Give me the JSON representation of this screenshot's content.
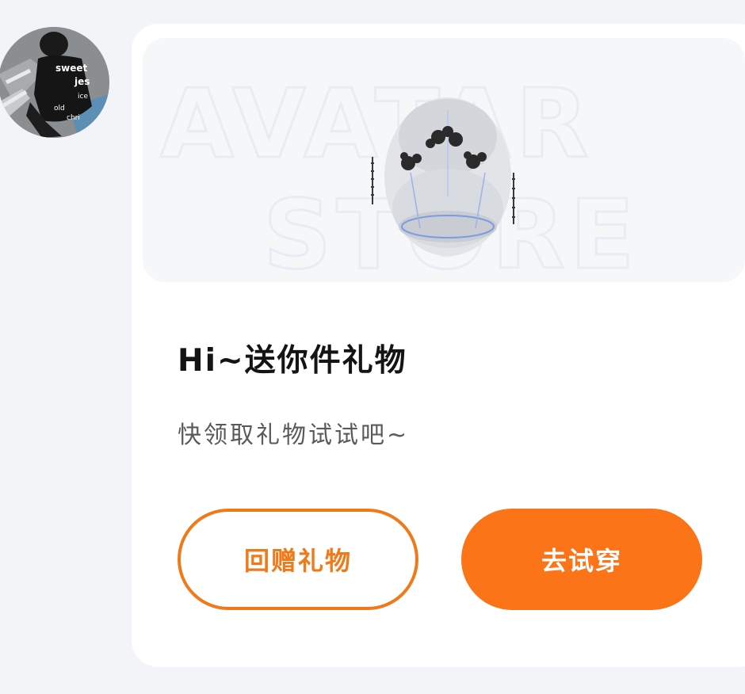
{
  "message": {
    "title": "Hi~送你件礼物",
    "subtitle": "快领取礼物试试吧~",
    "banner": {
      "watermark_line1": "AVATAR",
      "watermark_line2": "STORE"
    },
    "avatar_shirt_text": [
      "sweet",
      "jes",
      "ice",
      "old",
      "chri"
    ],
    "buttons": {
      "gift_back": "回赠礼物",
      "try_on": "去试穿"
    }
  },
  "colors": {
    "accent": "#fb7418",
    "outline": "#f07a1a",
    "page_background": "#f2f4f7",
    "card_background": "#ffffff"
  }
}
